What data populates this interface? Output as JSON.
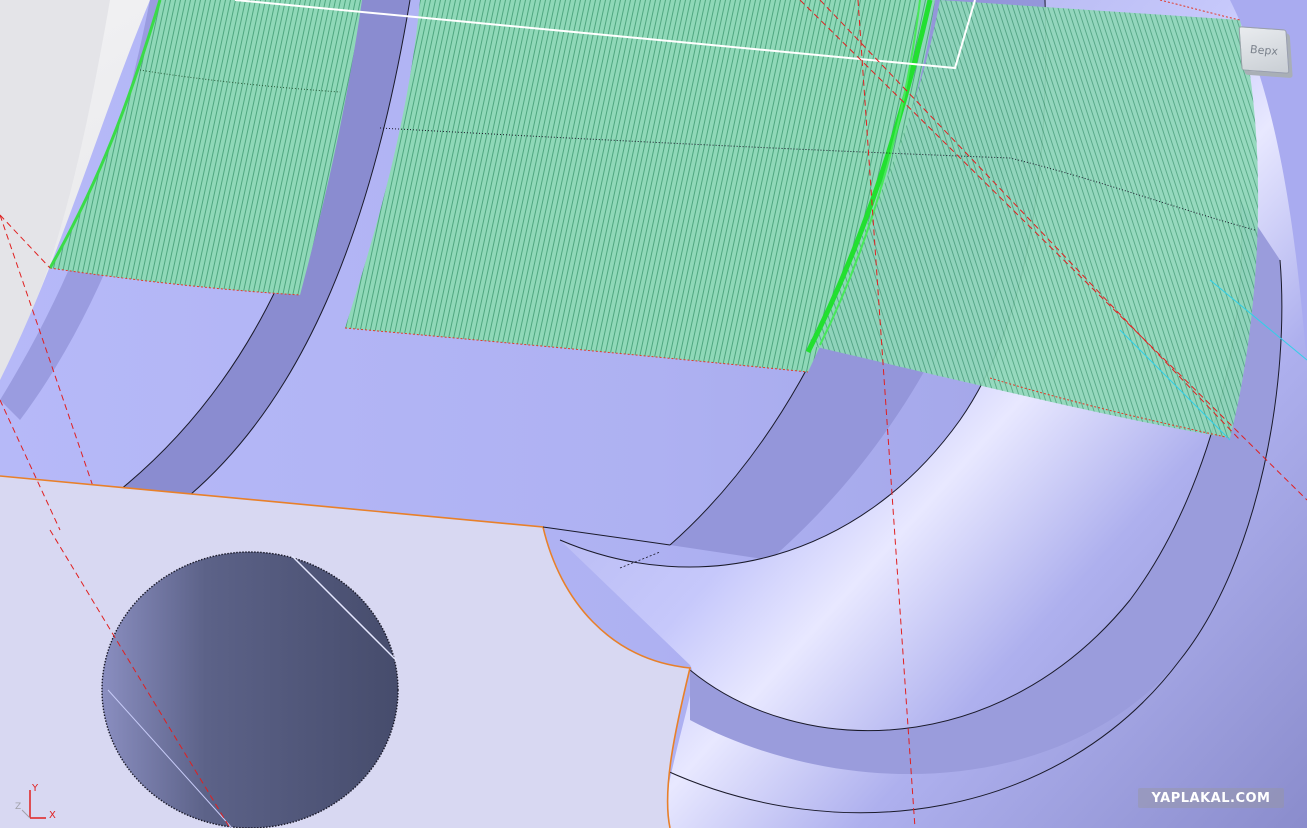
{
  "view_cube": {
    "face_label": "Верх"
  },
  "axis_triad": {
    "x_label": "X",
    "y_label": "Y",
    "z_label": "Z"
  },
  "watermark": {
    "text": "YAPLAKAL.COM"
  },
  "colors": {
    "surface": "#b0b4f6",
    "surface_shadow": "#8a8cc8",
    "flat_face": "#d6d6ee",
    "hole_inner": "#545a7a",
    "toolpath_green": "#28d040",
    "toolpath_fill": "#7fd4b0",
    "axis_red": "#e02020",
    "section_orange": "#e8802a",
    "edge_black": "#1a1a2a"
  }
}
